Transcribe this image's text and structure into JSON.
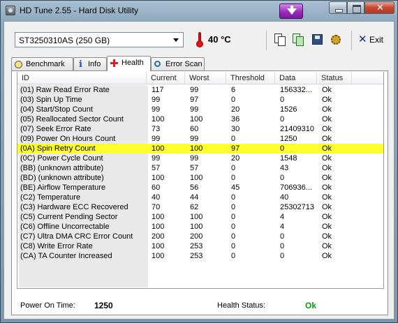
{
  "window": {
    "title": "HD Tune 2.55 - Hard Disk Utility"
  },
  "toolbar": {
    "drive": "ST3250310AS (250 GB)",
    "temperature": "40 °C",
    "exit_label": "Exit"
  },
  "tabs": [
    {
      "label": "Benchmark",
      "icon": "benchmark-icon"
    },
    {
      "label": "Info",
      "icon": "info-icon"
    },
    {
      "label": "Health",
      "icon": "health-icon",
      "active": true
    },
    {
      "label": "Error Scan",
      "icon": "error-scan-icon"
    }
  ],
  "table": {
    "columns": [
      "ID",
      "Current",
      "Worst",
      "Threshold",
      "Data",
      "Status"
    ],
    "highlight_color": "#ffff2e",
    "rows": [
      {
        "id": "(01) Raw Read Error Rate",
        "current": "117",
        "worst": "99",
        "threshold": "6",
        "data": "156332...",
        "status": "Ok"
      },
      {
        "id": "(03) Spin Up Time",
        "current": "99",
        "worst": "97",
        "threshold": "0",
        "data": "0",
        "status": "Ok"
      },
      {
        "id": "(04) Start/Stop Count",
        "current": "99",
        "worst": "99",
        "threshold": "20",
        "data": "1526",
        "status": "Ok"
      },
      {
        "id": "(05) Reallocated Sector Count",
        "current": "100",
        "worst": "100",
        "threshold": "36",
        "data": "0",
        "status": "Ok"
      },
      {
        "id": "(07) Seek Error Rate",
        "current": "73",
        "worst": "60",
        "threshold": "30",
        "data": "21409310",
        "status": "Ok"
      },
      {
        "id": "(09) Power On Hours Count",
        "current": "99",
        "worst": "99",
        "threshold": "0",
        "data": "1250",
        "status": "Ok"
      },
      {
        "id": "(0A) Spin Retry Count",
        "current": "100",
        "worst": "100",
        "threshold": "97",
        "data": "0",
        "status": "Ok",
        "highlight": true
      },
      {
        "id": "(0C) Power Cycle Count",
        "current": "99",
        "worst": "99",
        "threshold": "20",
        "data": "1548",
        "status": "Ok"
      },
      {
        "id": "(BB) (unknown attribute)",
        "current": "57",
        "worst": "57",
        "threshold": "0",
        "data": "43",
        "status": "Ok"
      },
      {
        "id": "(BD) (unknown attribute)",
        "current": "100",
        "worst": "100",
        "threshold": "0",
        "data": "0",
        "status": "Ok"
      },
      {
        "id": "(BE) Airflow Temperature",
        "current": "60",
        "worst": "56",
        "threshold": "45",
        "data": "706936...",
        "status": "Ok"
      },
      {
        "id": "(C2) Temperature",
        "current": "40",
        "worst": "44",
        "threshold": "0",
        "data": "40",
        "status": "Ok"
      },
      {
        "id": "(C3) Hardware ECC Recovered",
        "current": "70",
        "worst": "62",
        "threshold": "0",
        "data": "25302713",
        "status": "Ok"
      },
      {
        "id": "(C5) Current Pending Sector",
        "current": "100",
        "worst": "100",
        "threshold": "0",
        "data": "4",
        "status": "Ok"
      },
      {
        "id": "(C6) Offline Uncorrectable",
        "current": "100",
        "worst": "100",
        "threshold": "0",
        "data": "4",
        "status": "Ok"
      },
      {
        "id": "(C7) Ultra DMA CRC Error Count",
        "current": "200",
        "worst": "200",
        "threshold": "0",
        "data": "0",
        "status": "Ok"
      },
      {
        "id": "(C8) Write Error Rate",
        "current": "100",
        "worst": "253",
        "threshold": "0",
        "data": "0",
        "status": "Ok"
      },
      {
        "id": "(CA) TA Counter Increased",
        "current": "100",
        "worst": "253",
        "threshold": "0",
        "data": "0",
        "status": "Ok"
      }
    ]
  },
  "status": {
    "power_on_label": "Power On Time:",
    "power_on_value": "1250",
    "health_label": "Health Status:",
    "health_value": "Ok",
    "health_color": "#0c9a12"
  }
}
